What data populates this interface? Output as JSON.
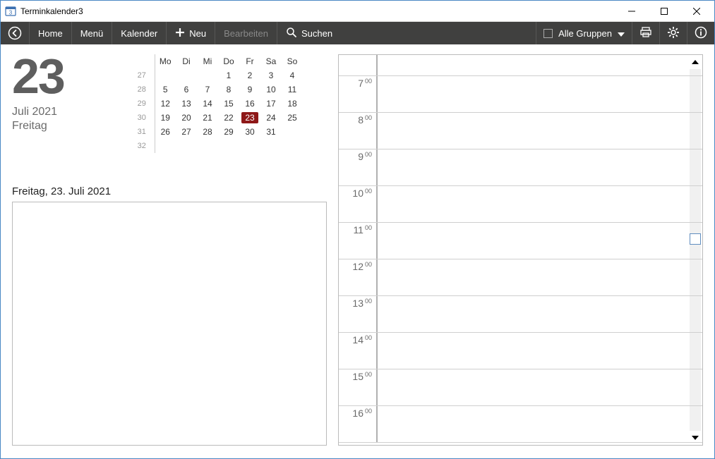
{
  "window": {
    "title": "Terminkalender3"
  },
  "toolbar": {
    "home": "Home",
    "menu": "Menü",
    "calendar": "Kalender",
    "new": "Neu",
    "edit": "Bearbeiten",
    "search": "Suchen",
    "groups": "Alle Gruppen"
  },
  "date": {
    "big_day": "23",
    "month_year": "Juli 2021",
    "weekday": "Freitag",
    "long": "Freitag, 23. Juli 2021"
  },
  "mini_cal": {
    "dow": [
      "Mo",
      "Di",
      "Mi",
      "Do",
      "Fr",
      "Sa",
      "So"
    ],
    "weeks": [
      {
        "wk": "27",
        "days": [
          "",
          "",
          "",
          "1",
          "2",
          "3",
          "4"
        ]
      },
      {
        "wk": "28",
        "days": [
          "5",
          "6",
          "7",
          "8",
          "9",
          "10",
          "11"
        ]
      },
      {
        "wk": "29",
        "days": [
          "12",
          "13",
          "14",
          "15",
          "16",
          "17",
          "18"
        ]
      },
      {
        "wk": "30",
        "days": [
          "19",
          "20",
          "21",
          "22",
          "23",
          "24",
          "25"
        ]
      },
      {
        "wk": "31",
        "days": [
          "26",
          "27",
          "28",
          "29",
          "30",
          "31",
          ""
        ]
      },
      {
        "wk": "32",
        "days": [
          "",
          "",
          "",
          "",
          "",
          "",
          ""
        ]
      }
    ],
    "today": "23"
  },
  "timeline": {
    "hours": [
      "7",
      "8",
      "9",
      "10",
      "11",
      "12",
      "13",
      "14",
      "15",
      "16"
    ],
    "minute_label": "00"
  }
}
